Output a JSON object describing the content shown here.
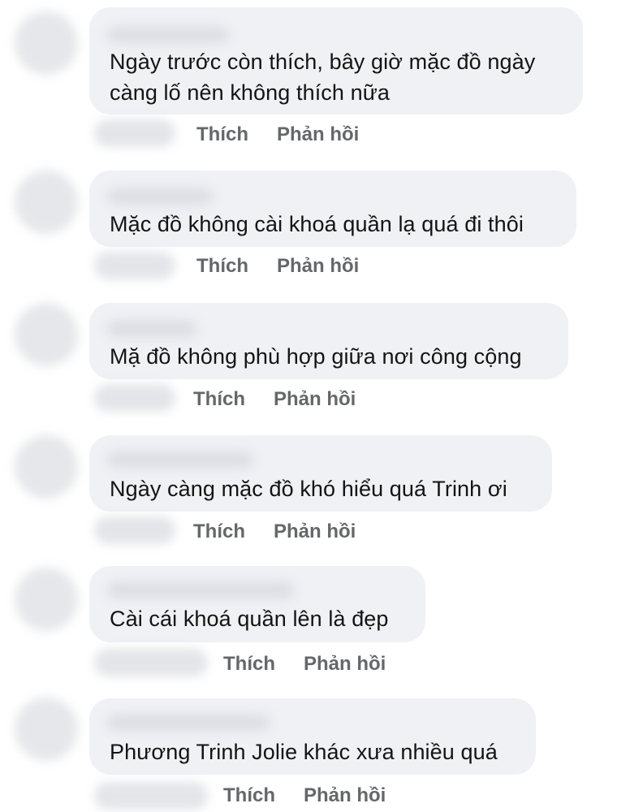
{
  "actions": {
    "like_label": "Thích",
    "reply_label": "Phản hồi"
  },
  "comments": [
    {
      "text": "Ngày trước còn thích, bây giờ mặc đồ ngày càng lố nên không thích nữa"
    },
    {
      "text": "Mặc đồ không cài khoá quần lạ quá đi thôi"
    },
    {
      "text": "Mặ đồ không phù hợp giữa nơi công cộng"
    },
    {
      "text": "Ngày càng mặc đồ khó hiểu quá Trinh ơi"
    },
    {
      "text": "Cài cái khoá quần lên là đẹp"
    },
    {
      "text": "Phương Trinh Jolie khác xưa nhiều quá"
    }
  ]
}
